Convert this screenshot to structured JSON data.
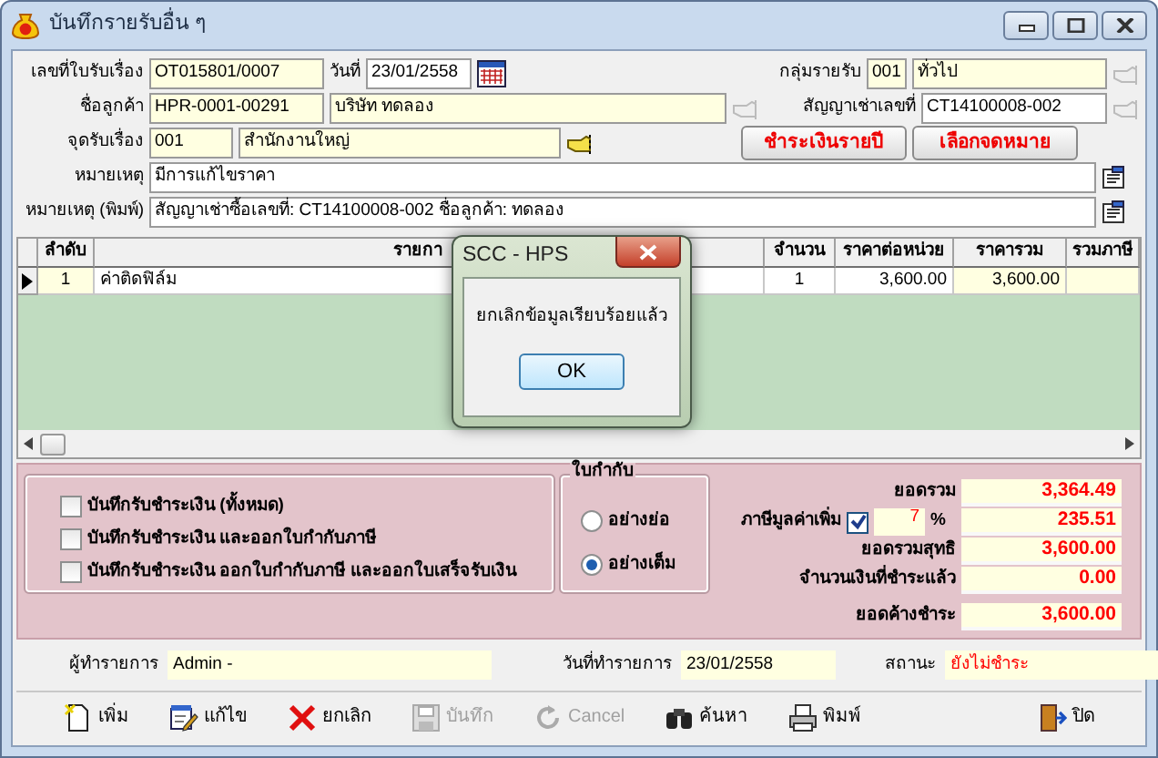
{
  "window": {
    "title": "บันทึกรายรับอื่น ๆ"
  },
  "form": {
    "receipt_no": {
      "label": "เลขที่ใบรับเรื่อง",
      "value": "OT015801/0007"
    },
    "date": {
      "label": "วันที่",
      "value": "23/01/2558"
    },
    "income_group": {
      "label": "กลุ่มรายรับ",
      "code": "001",
      "name": "ทั่วไป",
      "lookup_enabled": false
    },
    "customer": {
      "label": "ชื่อลูกค้า",
      "code": "HPR-0001-00291",
      "name": "บริษัท ทดลอง",
      "lookup_enabled": false
    },
    "contract": {
      "label": "สัญญาเช่าเลขที่",
      "value": "CT14100008-002",
      "lookup_enabled": false
    },
    "receive_point": {
      "label": "จุดรับเรื่อง",
      "code": "001",
      "name": "สำนักงานใหญ่",
      "lookup_enabled": true
    },
    "buttons": [
      "ชำระเงินรายปี",
      "เลือกจดหมาย"
    ],
    "note": {
      "label": "หมายเหตุ",
      "value": "มีการแก้ไขราคา"
    },
    "print_note": {
      "label": "หมายเหตุ (พิมพ์)",
      "value": "สัญญาเช่าซื้อเลขที่: CT14100008-002 ชื่อลูกค้า: ทดลอง"
    }
  },
  "grid": {
    "columns": [
      "ลำดับ",
      "รายกา",
      "จำนวน",
      "ราคาต่อหน่วย",
      "ราคารวม",
      "รวมภาษี"
    ],
    "rows": [
      {
        "cells": [
          "1",
          "ค่าติดฟิล์ม",
          "1",
          "3,600.00",
          "3,600.00",
          ""
        ],
        "current": true
      }
    ]
  },
  "dialog": {
    "title": "SCC - HPS",
    "message": "ยกเลิกข้อมูลเรียบร้อยแล้ว",
    "button": "OK"
  },
  "payment_options": [
    {
      "label": "บันทึกรับชำระเงิน (ทั้งหมด)",
      "checked": false
    },
    {
      "label": "บันทึกรับชำระเงิน และออกใบกำกับภาษี",
      "checked": false
    },
    {
      "label": "บันทึกรับชำระเงิน ออกใบกำกับภาษี และออกใบเสร็จรับเงิน",
      "checked": false
    }
  ],
  "receipt_type": {
    "title": "ใบกำกับ",
    "options": [
      {
        "label": "อย่างย่อ",
        "selected": false
      },
      {
        "label": "อย่างเต็ม",
        "selected": true
      }
    ]
  },
  "totals": [
    {
      "kind": "amount",
      "label": "ยอดรวม",
      "value": "3,364.49"
    },
    {
      "kind": "vat",
      "label": "ภาษีมูลค่าเพิ่ม",
      "checked": true,
      "rate": "7",
      "unit": "%",
      "value": "235.51"
    },
    {
      "kind": "amount",
      "label": "ยอดรวมสุทธิ",
      "value": "3,600.00"
    },
    {
      "kind": "amount",
      "label": "จำนวนเงินที่ชำระแล้ว",
      "value": "0.00"
    },
    {
      "kind": "balance",
      "label": "ยอดค้างชำระ",
      "value": "3,600.00"
    }
  ],
  "info": [
    {
      "label": "ผู้ทำรายการ",
      "value": "Admin -",
      "alert": false
    },
    {
      "label": "วันที่ทำรายการ",
      "value": "23/01/2558",
      "alert": false
    },
    {
      "label": "สถานะ",
      "value": "ยังไม่ชำระ",
      "alert": true
    }
  ],
  "toolbar": [
    {
      "label": "เพิ่ม",
      "disabled": false
    },
    {
      "label": "แก้ไข",
      "disabled": false
    },
    {
      "label": "ยกเลิก",
      "disabled": false
    },
    {
      "label": "บันทึก",
      "disabled": true
    },
    {
      "label": "Cancel",
      "disabled": true
    },
    {
      "label": "ค้นหา",
      "disabled": false
    },
    {
      "label": "พิมพ์",
      "disabled": false
    },
    {
      "label": "ปิด",
      "disabled": false
    }
  ]
}
